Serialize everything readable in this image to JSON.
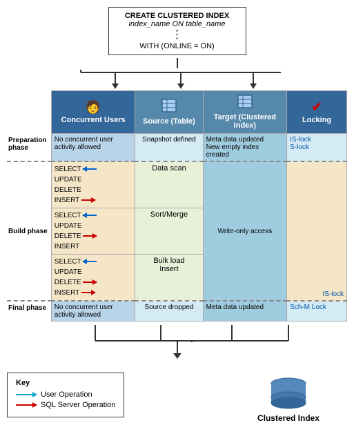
{
  "sql": {
    "line1": "CREATE CLUSTERED INDEX",
    "line2": "index_name ON table_name",
    "dots": "⋮",
    "line3": "WITH (ONLINE = ON)"
  },
  "headers": {
    "concurrent": "Concurrent Users",
    "source": "Source (Table)",
    "target": "Target (Clustered Index)",
    "locking": "Locking"
  },
  "phases": {
    "prep": {
      "label": "Preparation phase",
      "concurrent": "No concurrent user activity allowed",
      "source": "Snapshot defined",
      "target": "Meta data updated New empty index created",
      "locking": "IS-lock S-lock"
    },
    "build": {
      "label": "Build phase",
      "rows": [
        {
          "ops": "SELECT ←\nUPDATE\nDELETE\nINSERT",
          "source": "Data scan",
          "target": "Write-only access",
          "locking": ""
        },
        {
          "ops": "SELECT ←\nUPDATE\nDELETE\nINSERT",
          "source": "Sort/Merge",
          "target": "",
          "locking": ""
        },
        {
          "ops": "SELECT ←\nUPDATE\nDELETE\nINSERT",
          "source": "Bulk load Insert",
          "target": "",
          "locking": "IS-lock"
        }
      ]
    },
    "final": {
      "label": "Final phase",
      "concurrent": "No concurrent user activity allowed",
      "source": "Source dropped",
      "target": "Meta data updated",
      "locking": "Sch-M Lock"
    }
  },
  "key": {
    "title": "Key",
    "user_op": "User Operation",
    "sql_op": "SQL Server Operation"
  },
  "clustered_index_label": "Clustered Index"
}
